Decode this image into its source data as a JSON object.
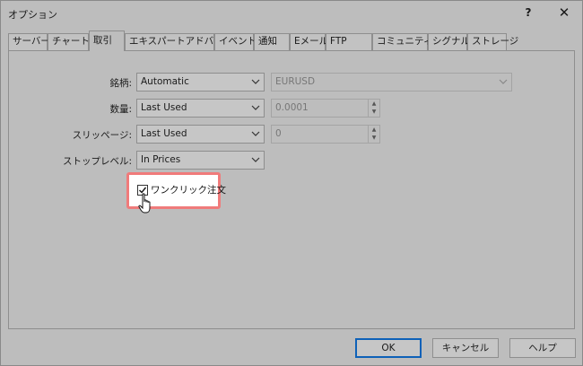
{
  "window": {
    "title": "オプション",
    "help_label": "?",
    "close_label": "✕"
  },
  "tabs": [
    {
      "label": "サーバー"
    },
    {
      "label": "チャート"
    },
    {
      "label": "取引",
      "active": true
    },
    {
      "label": "エキスパートアドバイザ"
    },
    {
      "label": "イベント"
    },
    {
      "label": "通知"
    },
    {
      "label": "Eメール"
    },
    {
      "label": "FTP"
    },
    {
      "label": "コミュニティー"
    },
    {
      "label": "シグナル"
    },
    {
      "label": "ストレージ"
    }
  ],
  "form": {
    "symbol": {
      "label": "銘柄:",
      "value": "Automatic",
      "symbol_value": "EURUSD"
    },
    "volume": {
      "label": "数量:",
      "value": "Last Used",
      "amount": "0.0001"
    },
    "slippage": {
      "label": "スリッページ:",
      "value": "Last Used",
      "amount": "0"
    },
    "stop_level": {
      "label": "ストップレベル:",
      "value": "In Prices"
    }
  },
  "one_click": {
    "label": "ワンクリック注文",
    "checked": true
  },
  "buttons": {
    "ok": "OK",
    "cancel": "キャンセル",
    "help": "ヘルプ"
  },
  "colors": {
    "overlay": "#bdbdbd",
    "highlight_border": "#f07b7b",
    "default_button_border": "#0e61b8"
  }
}
